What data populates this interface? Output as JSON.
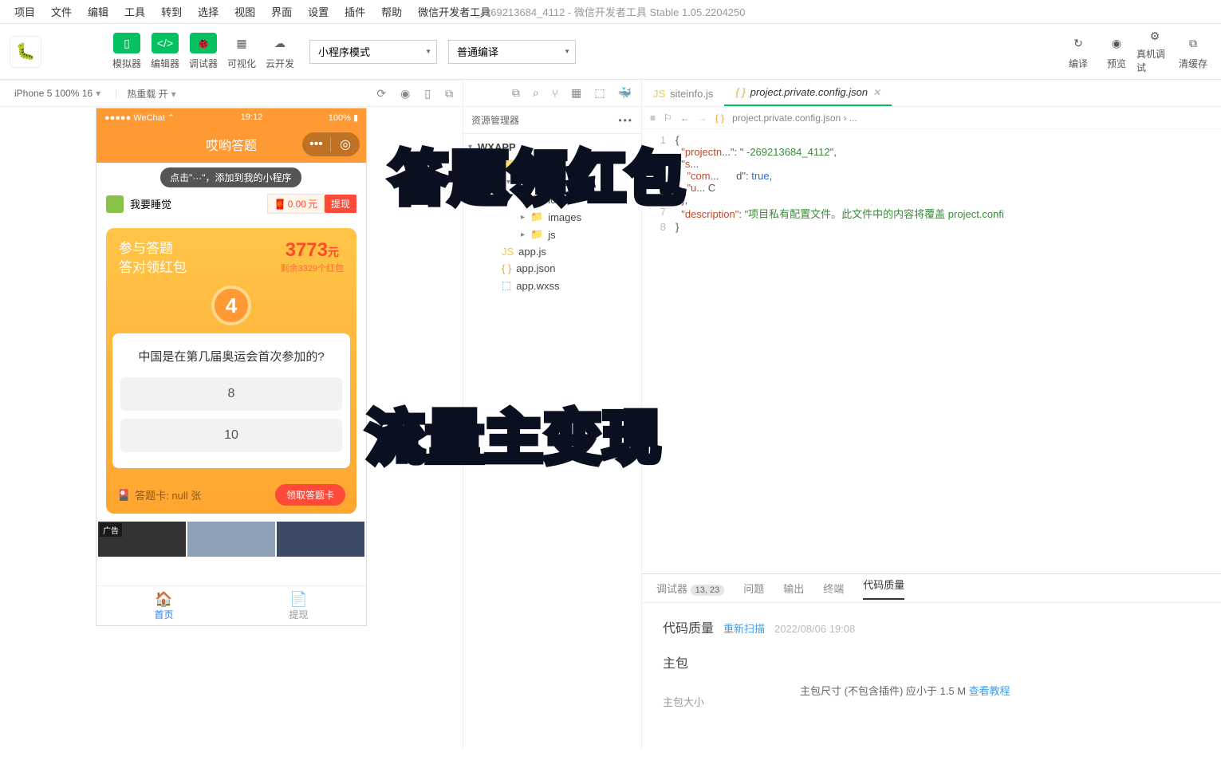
{
  "menubar": {
    "items": [
      "项目",
      "文件",
      "编辑",
      "工具",
      "转到",
      "选择",
      "视图",
      "界面",
      "设置",
      "插件",
      "帮助",
      "微信开发者工具"
    ],
    "title": "_-269213684_4112 - 微信开发者工具 Stable 1.05.2204250"
  },
  "toolbar": {
    "simulator": "模拟器",
    "editor": "编辑器",
    "debugger": "调试器",
    "visual": "可视化",
    "cloud": "云开发",
    "mode": "小程序模式",
    "compileMode": "普通编译",
    "compile": "编译",
    "preview": "预览",
    "remote": "真机调试",
    "clearCache": "清缓存"
  },
  "devicebar": {
    "device": "iPhone 5 100% 16",
    "hotreload": "热重载 开"
  },
  "phone": {
    "carrier": "●●●●● WeChat ⌃",
    "time": "19:12",
    "battery": "100%",
    "navTitle": "哎哟答题",
    "hint": "点击\"···\"，添加到我的小程序",
    "username": "我要睡觉",
    "balance": "0.00",
    "balanceUnit": "元",
    "withdraw": "提现",
    "cardTitle1": "参与答题",
    "cardTitle2": "答对领红包",
    "amount": "3773",
    "amountUnit": "元",
    "remain": "剩余3329个红包",
    "badge": "4",
    "question": "中国是在第几届奥运会首次参加的?",
    "answers": [
      "8",
      "10"
    ],
    "answerCardLabel": "答题卡:  null 张",
    "getCard": "领取答题卡",
    "adLabel": "广告",
    "tabs": {
      "home": "首页",
      "withdraw": "提现"
    }
  },
  "explorer": {
    "title": "资源管理器",
    "root": "WXAPP",
    "items": [
      {
        "name": "we7",
        "type": "folder",
        "open": true,
        "depth": 2
      },
      {
        "name": "resource",
        "type": "folder",
        "open": true,
        "depth": 3
      },
      {
        "name": "icon",
        "type": "folder",
        "open": false,
        "depth": 4
      },
      {
        "name": "images",
        "type": "folder",
        "open": false,
        "depth": 4
      },
      {
        "name": "js",
        "type": "folder",
        "open": false,
        "depth": 4
      },
      {
        "name": "app.js",
        "type": "js",
        "depth": 2
      },
      {
        "name": "app.json",
        "type": "json",
        "depth": 2
      },
      {
        "name": "app.wxss",
        "type": "wxss",
        "depth": 2
      }
    ]
  },
  "editor": {
    "tabs": [
      {
        "name": "siteinfo.js",
        "active": false,
        "icon": "js"
      },
      {
        "name": "project.private.config.json",
        "active": true,
        "icon": "json"
      }
    ],
    "breadcrumb": "project.private.config.json › ...",
    "lines": [
      {
        "n": "1",
        "c": [
          [
            "pun",
            "{"
          ]
        ]
      },
      {
        "n": "",
        "c": [
          [
            "key",
            "  \"projectn"
          ],
          [
            "pun",
            "...\": \""
          ],
          [
            "str",
            " -269213684_4112"
          ],
          [
            "pun",
            "\","
          ]
        ]
      },
      {
        "n": "",
        "c": [
          [
            "key",
            "  \"s"
          ],
          [
            "pun",
            "..."
          ]
        ]
      },
      {
        "n": "",
        "c": [
          [
            "key",
            "    \"com"
          ],
          [
            "pun",
            "...      d\": "
          ],
          [
            "bool",
            "true"
          ],
          [
            "pun",
            ","
          ]
        ]
      },
      {
        "n": "",
        "c": [
          [
            "key",
            "    \"u"
          ],
          [
            "pun",
            "... C"
          ]
        ]
      },
      {
        "n": "6",
        "c": [
          [
            "pun",
            "  },"
          ]
        ]
      },
      {
        "n": "7",
        "c": [
          [
            "key",
            "  \"description\""
          ],
          [
            "pun",
            ": "
          ],
          [
            "str",
            "\"项目私有配置文件。此文件中的内容将覆盖 project.confi"
          ]
        ]
      },
      {
        "n": "8",
        "c": [
          [
            "pun",
            "}"
          ]
        ]
      }
    ]
  },
  "debug": {
    "tabs": [
      "调试器",
      "问题",
      "输出",
      "终端",
      "代码质量"
    ],
    "badge": "13, 23",
    "active": "代码质量",
    "title": "代码质量",
    "rescan": "重新扫描",
    "timestamp": "2022/08/06 19:08",
    "section": "主包",
    "sizeLabel": "主包大小",
    "sizeInfo": "主包尺寸 (不包含插件) 应小于 1.5 M ",
    "tutorial": "查看教程"
  },
  "overlay": {
    "line1": "答题领红包",
    "line2": "流量主变现"
  }
}
